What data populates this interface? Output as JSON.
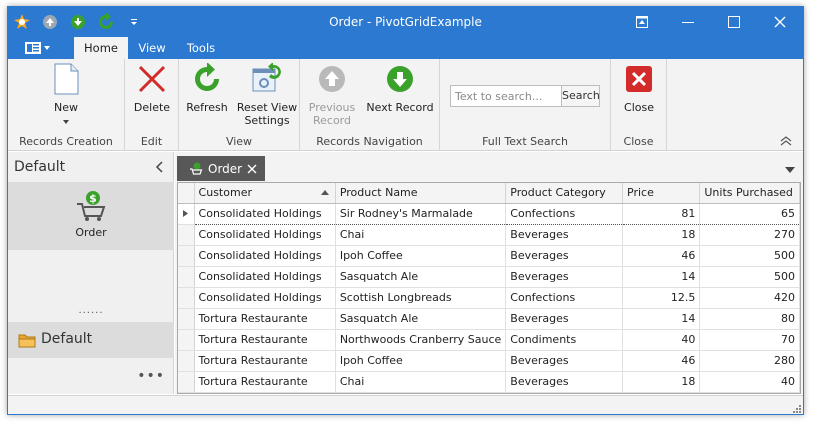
{
  "window": {
    "title": "Order - PivotGridExample"
  },
  "title_bar": {
    "qat": [
      "app-logo-icon",
      "back-icon",
      "save-icon",
      "refresh-icon",
      "customize-qat-icon"
    ],
    "controls": [
      "restore-ribbon-icon",
      "minimize-icon",
      "maximize-icon",
      "close-icon"
    ]
  },
  "ribbon_tabs": {
    "home": "Home",
    "view": "View",
    "tools": "Tools"
  },
  "ribbon": {
    "groups": {
      "records_creation": "Records Creation",
      "edit": "Edit",
      "view": "View",
      "records_navigation": "Records Navigation",
      "full_text_search": "Full Text Search",
      "close": "Close"
    },
    "buttons": {
      "new": "New",
      "delete": "Delete",
      "refresh": "Refresh",
      "reset_view_1": "Reset View",
      "reset_view_2": "Settings",
      "previous_1": "Previous",
      "previous_2": "Record",
      "next": "Next Record",
      "close": "Close"
    },
    "search": {
      "placeholder": "Text to search...",
      "button": "Search"
    }
  },
  "nav": {
    "header": "Default",
    "items": [
      {
        "label": "Order"
      }
    ],
    "group": "Default",
    "splitter": "......",
    "more": "•••"
  },
  "document": {
    "tab": "Order"
  },
  "grid": {
    "columns": [
      "Customer",
      "Product Name",
      "Product Category",
      "Price",
      "Units Purchased"
    ],
    "rows": [
      [
        "Consolidated Holdings",
        "Sir Rodney's Marmalade",
        "Confections",
        "81",
        "65"
      ],
      [
        "Consolidated Holdings",
        "Chai",
        "Beverages",
        "18",
        "270"
      ],
      [
        "Consolidated Holdings",
        "Ipoh Coffee",
        "Beverages",
        "46",
        "500"
      ],
      [
        "Consolidated Holdings",
        "Sasquatch Ale",
        "Beverages",
        "14",
        "500"
      ],
      [
        "Consolidated Holdings",
        "Scottish Longbreads",
        "Confections",
        "12.5",
        "420"
      ],
      [
        "Tortura Restaurante",
        "Sasquatch Ale",
        "Beverages",
        "14",
        "80"
      ],
      [
        "Tortura Restaurante",
        "Northwoods Cranberry Sauce",
        "Condiments",
        "40",
        "70"
      ],
      [
        "Tortura Restaurante",
        "Ipoh Coffee",
        "Beverages",
        "46",
        "280"
      ],
      [
        "Tortura Restaurante",
        "Chai",
        "Beverages",
        "18",
        "40"
      ]
    ]
  },
  "colors": {
    "accent": "#2b79d0",
    "ribbon_bg": "#f3f3f3",
    "delete_red": "#d32a2a",
    "green": "#3aa12a"
  }
}
